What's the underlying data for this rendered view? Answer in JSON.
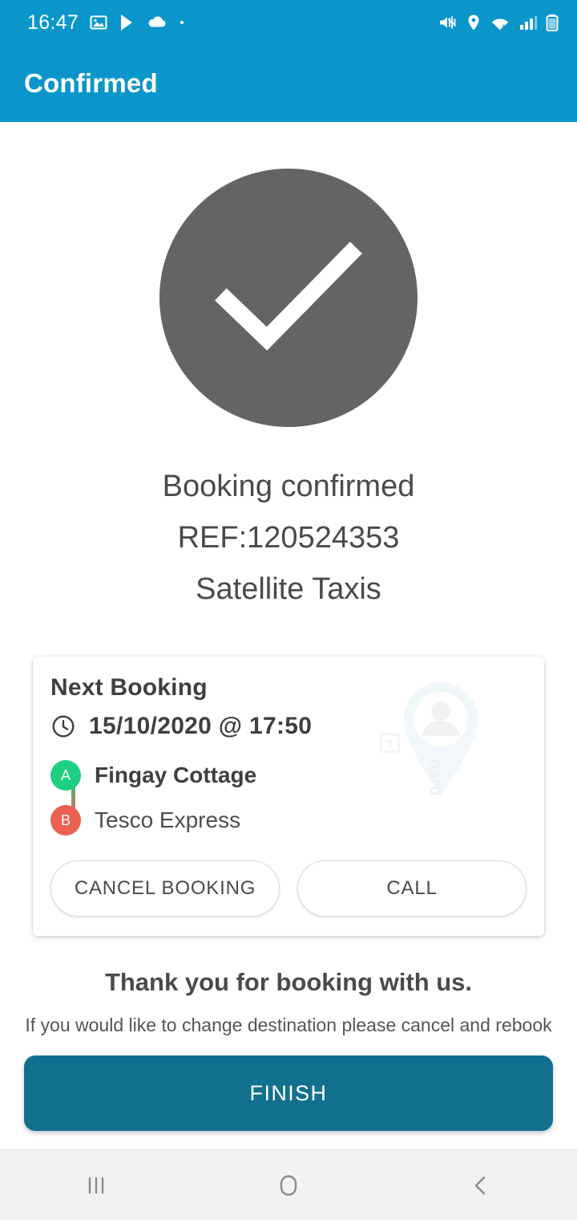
{
  "status_bar": {
    "time": "16:47",
    "left_icons": [
      "image-icon",
      "play-store-icon",
      "cloud-icon",
      "dot-icon"
    ],
    "right_icons": [
      "mute-vibrate-icon",
      "location-icon",
      "wifi-icon",
      "signal-icon",
      "battery-icon"
    ]
  },
  "app_bar": {
    "title": "Confirmed",
    "background_color": "#0a96cb"
  },
  "confirmation": {
    "icon": "check-circle-icon",
    "circle_color": "#646464",
    "line1": "Booking confirmed",
    "line2": "REF:120524353",
    "line3": "Satellite Taxis"
  },
  "booking_card": {
    "title": "Next Booking",
    "clock_icon": "clock-icon",
    "datetime": "15/10/2020 @ 17:50",
    "watermark_icon": "map-pin-avatar-watermark",
    "watermark_text": "hard",
    "pickup": {
      "marker": "A",
      "marker_color": "#1ecf82",
      "name": "Fingay Cottage"
    },
    "dropoff": {
      "marker": "B",
      "marker_color": "#ea6152",
      "name": "Tesco Express"
    },
    "cancel_label": "CANCEL BOOKING",
    "call_label": "CALL"
  },
  "footer": {
    "thanks": "Thank you for booking with us.",
    "note": "If you would like to change destination please cancel and rebook",
    "finish_label": "FINISH",
    "finish_color": "#12708f"
  },
  "nav_bar": {
    "recents": "recents-icon",
    "home": "home-icon",
    "back": "back-icon"
  }
}
